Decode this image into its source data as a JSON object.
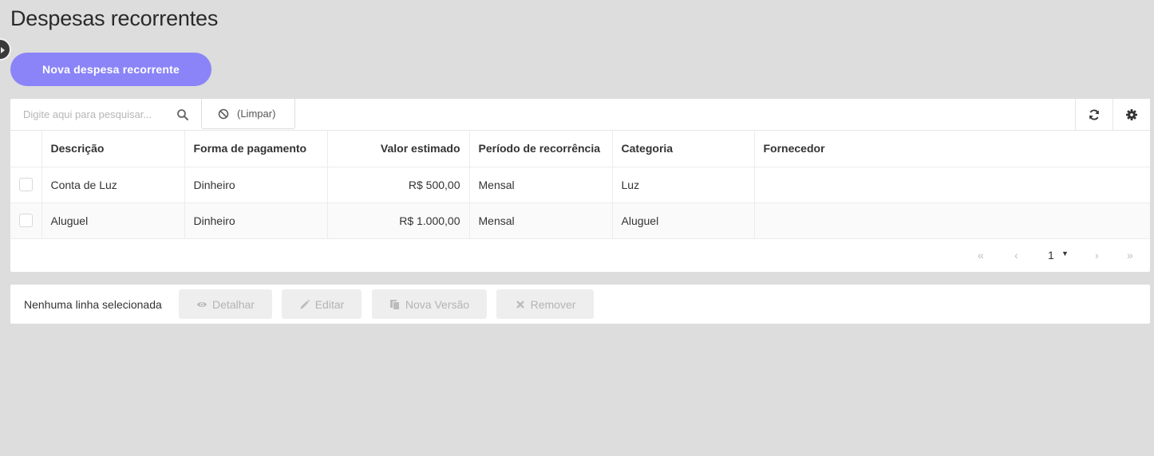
{
  "page": {
    "title": "Despesas recorrentes"
  },
  "header": {
    "new_button_label": "Nova despesa recorrente"
  },
  "toolbar": {
    "search_placeholder": "Digite aqui para pesquisar...",
    "clear_label": "(Limpar)",
    "icons": {
      "search": "search-icon",
      "clear": "ban-icon",
      "refresh": "refresh-icon",
      "settings": "gear-icon"
    }
  },
  "table": {
    "columns": [
      "Descrição",
      "Forma de pagamento",
      "Valor estimado",
      "Período de recorrência",
      "Categoria",
      "Fornecedor"
    ],
    "rows": [
      {
        "descricao": "Conta de Luz",
        "forma": "Dinheiro",
        "valor": "R$ 500,00",
        "periodo": "Mensal",
        "categoria": "Luz",
        "fornecedor": ""
      },
      {
        "descricao": "Aluguel",
        "forma": "Dinheiro",
        "valor": "R$ 1.000,00",
        "periodo": "Mensal",
        "categoria": "Aluguel",
        "fornecedor": ""
      }
    ]
  },
  "pagination": {
    "first": "«",
    "prev": "‹",
    "current_page": "1",
    "caret": "▼",
    "next": "›",
    "last": "»"
  },
  "actions": {
    "selection_status": "Nenhuma linha selecionada",
    "detail_label": "Detalhar",
    "edit_label": "Editar",
    "version_label": "Nova Versão",
    "remove_label": "Remover"
  },
  "colors": {
    "accent": "#8a84f8",
    "background": "#dcdddc",
    "disabled_button": "#eeeeee"
  }
}
